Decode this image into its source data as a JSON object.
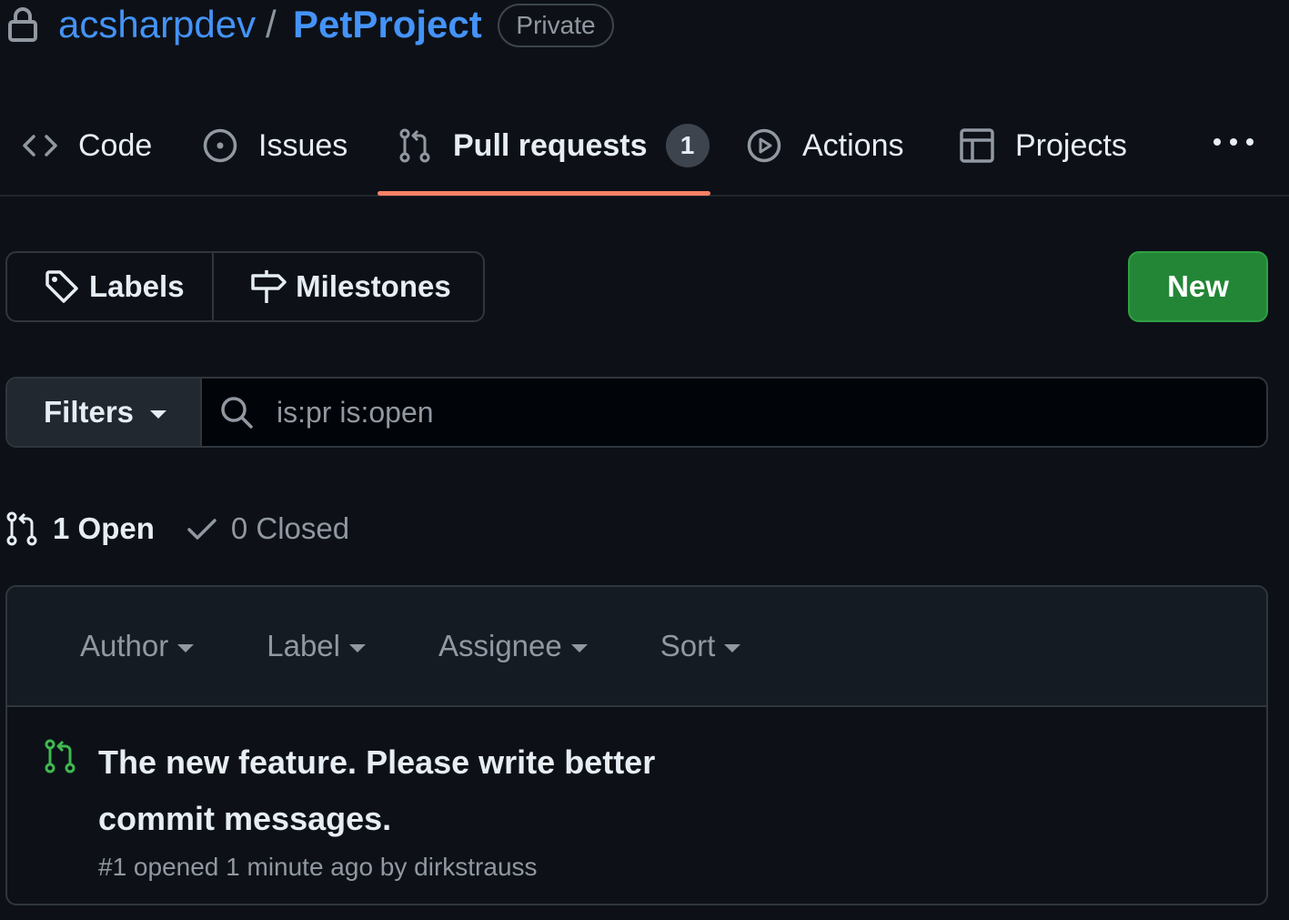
{
  "repo": {
    "owner": "acsharpdev",
    "separator": "/",
    "name": "PetProject",
    "visibility": "Private"
  },
  "tabs": [
    {
      "label": "Code",
      "icon": "code-icon"
    },
    {
      "label": "Issues",
      "icon": "issue-icon"
    },
    {
      "label": "Pull requests",
      "icon": "pull-request-icon",
      "count": "1",
      "selected": true
    },
    {
      "label": "Actions",
      "icon": "play-icon"
    },
    {
      "label": "Projects",
      "icon": "table-icon"
    }
  ],
  "toolbar": {
    "labels": "Labels",
    "milestones": "Milestones",
    "new": "New"
  },
  "search": {
    "filters_label": "Filters",
    "query": "is:pr is:open"
  },
  "states": {
    "open": "1 Open",
    "closed": "0 Closed"
  },
  "list_header": {
    "author": "Author",
    "label": "Label",
    "assignee": "Assignee",
    "sort": "Sort"
  },
  "pull_requests": [
    {
      "title": "The new feature. Please write better commit messages.",
      "meta": "#1 opened 1 minute ago by dirkstrauss"
    }
  ],
  "colors": {
    "background": "#0d1117",
    "link": "#4493f8",
    "accent_underline": "#f78166",
    "new_button": "#238636",
    "open_pr_icon": "#3fb950",
    "muted_text": "#9198a1"
  }
}
